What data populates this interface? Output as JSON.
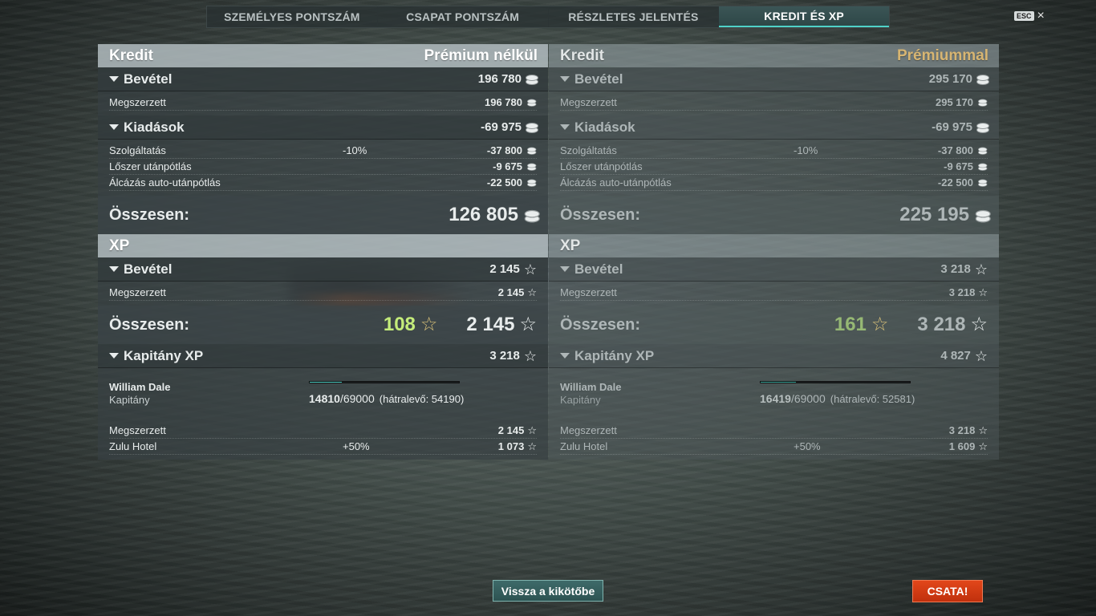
{
  "tabs": [
    {
      "label": "SZEMÉLYES PONTSZÁM"
    },
    {
      "label": "CSAPAT PONTSZÁM"
    },
    {
      "label": "RÉSZLETES JELENTÉS"
    },
    {
      "label": "KREDIT ÉS XP"
    }
  ],
  "active_tab": "KREDIT ÉS XP",
  "esc": {
    "key": "ESC",
    "close": "×"
  },
  "left": {
    "credit_title": "Kredit",
    "credit_mode": "Prémium nélkül",
    "income_title": "Bevétel",
    "income_total": "196 780",
    "income_rows": [
      {
        "label": "Megszerzett",
        "value": "196 780"
      }
    ],
    "expense_title": "Kiadások",
    "expense_total": "-69 975",
    "expense_rows": [
      {
        "label": "Szolgáltatás",
        "pct": "-10%",
        "value": "-37 800"
      },
      {
        "label": "Lőszer utánpótlás",
        "pct": "",
        "value": "-9 675"
      },
      {
        "label": "Álcázás auto-utánpótlás",
        "pct": "",
        "value": "-22 500"
      }
    ],
    "credit_sum_label": "Összesen:",
    "credit_sum": "126 805",
    "xp_title": "XP",
    "xp_income_title": "Bevétel",
    "xp_income_total": "2 145",
    "xp_rows": [
      {
        "label": "Megszerzett",
        "value": "2 145"
      }
    ],
    "xp_sum_label": "Összesen:",
    "xp_sum_free": "108",
    "xp_sum": "2 145",
    "captain_title": "Kapitány XP",
    "captain_total": "3 218",
    "captain_name": "William Dale",
    "captain_rank": "Kapitány",
    "captain_current": "14810",
    "captain_max": "/69000",
    "captain_remaining": "(hátralevő: 54190)",
    "captain_progress": 0.2146,
    "captain_rows": [
      {
        "label": "Megszerzett",
        "pct": "",
        "value": "2 145"
      },
      {
        "label": "Zulu Hotel",
        "pct": "+50%",
        "value": "1 073"
      }
    ]
  },
  "right": {
    "credit_title": "Kredit",
    "credit_mode": "Prémiummal",
    "income_title": "Bevétel",
    "income_total": "295 170",
    "income_rows": [
      {
        "label": "Megszerzett",
        "value": "295 170"
      }
    ],
    "expense_title": "Kiadások",
    "expense_total": "-69 975",
    "expense_rows": [
      {
        "label": "Szolgáltatás",
        "pct": "-10%",
        "value": "-37 800"
      },
      {
        "label": "Lőszer utánpótlás",
        "pct": "",
        "value": "-9 675"
      },
      {
        "label": "Álcázás auto-utánpótlás",
        "pct": "",
        "value": "-22 500"
      }
    ],
    "credit_sum_label": "Összesen:",
    "credit_sum": "225 195",
    "xp_title": "XP",
    "xp_income_title": "Bevétel",
    "xp_income_total": "3 218",
    "xp_rows": [
      {
        "label": "Megszerzett",
        "value": "3 218"
      }
    ],
    "xp_sum_label": "Összesen:",
    "xp_sum_free": "161",
    "xp_sum": "3 218",
    "captain_title": "Kapitány XP",
    "captain_total": "4 827",
    "captain_name": "William Dale",
    "captain_rank": "Kapitány",
    "captain_current": "16419",
    "captain_max": "/69000",
    "captain_remaining": "(hátralevő: 52581)",
    "captain_progress": 0.238,
    "captain_rows": [
      {
        "label": "Megszerzett",
        "pct": "",
        "value": "3 218"
      },
      {
        "label": "Zulu Hotel",
        "pct": "+50%",
        "value": "1 609"
      }
    ]
  },
  "buttons": {
    "back_to_port": "Vissza a kikötőbe",
    "battle": "CSATA!"
  },
  "colors": {
    "accent": "#4fd2c8",
    "premium_gold": "#d7b572",
    "free_xp_green": "#c4ec7a",
    "battle_red": "#d63a12"
  },
  "icons": {
    "credit": "credit-coin-icon",
    "xp": "xp-star-icon"
  }
}
